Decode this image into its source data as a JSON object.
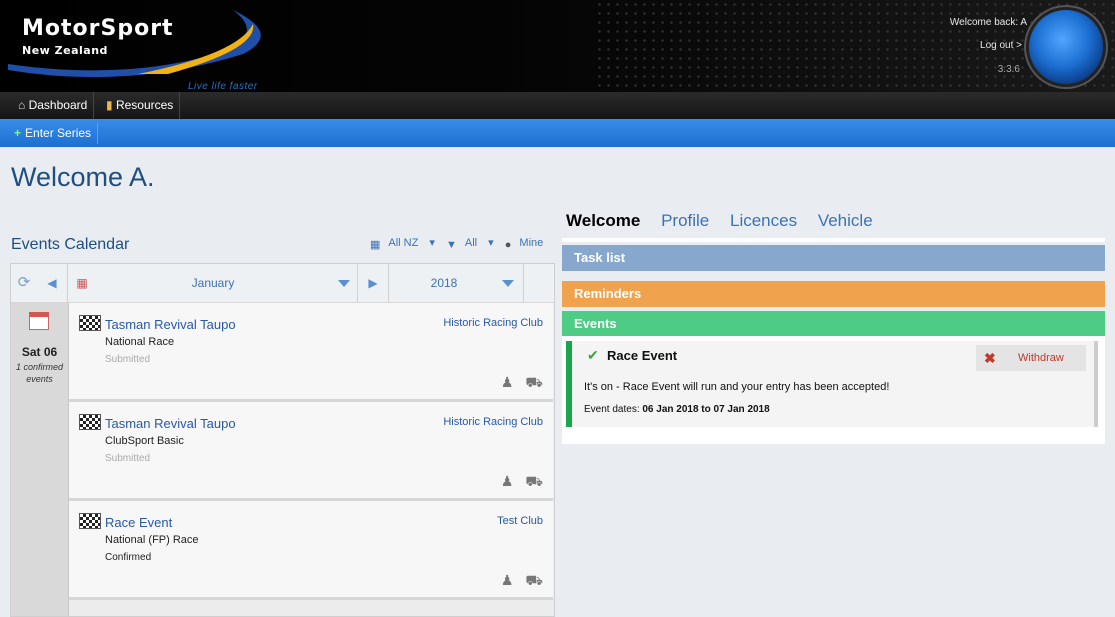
{
  "header": {
    "logo_title": "MotorSport",
    "logo_subtitle": "New Zealand",
    "tagline": "Live life faster",
    "welcome": "Welcome back: A",
    "logout": "Log out >",
    "version": "3.3.6"
  },
  "nav": {
    "items": [
      {
        "label": "Dashboard",
        "icon": "home-icon"
      },
      {
        "label": "Resources",
        "icon": "book-icon"
      }
    ],
    "sub": {
      "label": "Enter Series",
      "icon": "plus-icon"
    }
  },
  "page": {
    "title": "Welcome A."
  },
  "calendar": {
    "title": "Events Calendar",
    "filters": {
      "region": "All NZ",
      "filter": "All",
      "mine": "Mine"
    },
    "month": "January",
    "year": "2018",
    "date": {
      "day": "Sat 06",
      "count_line1": "1 confirmed",
      "count_line2": "events"
    },
    "events": [
      {
        "name": "Tasman Revival Taupo",
        "type": "National Race",
        "status": "Submitted",
        "club": "Historic Racing Club"
      },
      {
        "name": "Tasman Revival Taupo",
        "type": "ClubSport Basic",
        "status": "Submitted",
        "club": "Historic Racing Club"
      },
      {
        "name": "Race Event",
        "type": "National (FP) Race",
        "status": "Confirmed",
        "club": "Test Club"
      }
    ]
  },
  "right": {
    "tabs": [
      "Welcome",
      "Profile",
      "Licences",
      "Vehicle"
    ],
    "active_tab": "Welcome",
    "sections": {
      "tasks": "Task list",
      "reminders": "Reminders",
      "events": "Events"
    },
    "colors": {
      "tasks": "#87a8cc",
      "reminders": "#f0a24c",
      "events": "#4ecb84",
      "accepted": "#1aa54a"
    },
    "event_card": {
      "title": "Race Event",
      "withdraw": "Withdraw",
      "message": "It's on - Race Event will run and your entry has been accepted!",
      "dates_label": "Event dates:",
      "dates_value": "06 Jan 2018 to 07 Jan 2018"
    }
  }
}
